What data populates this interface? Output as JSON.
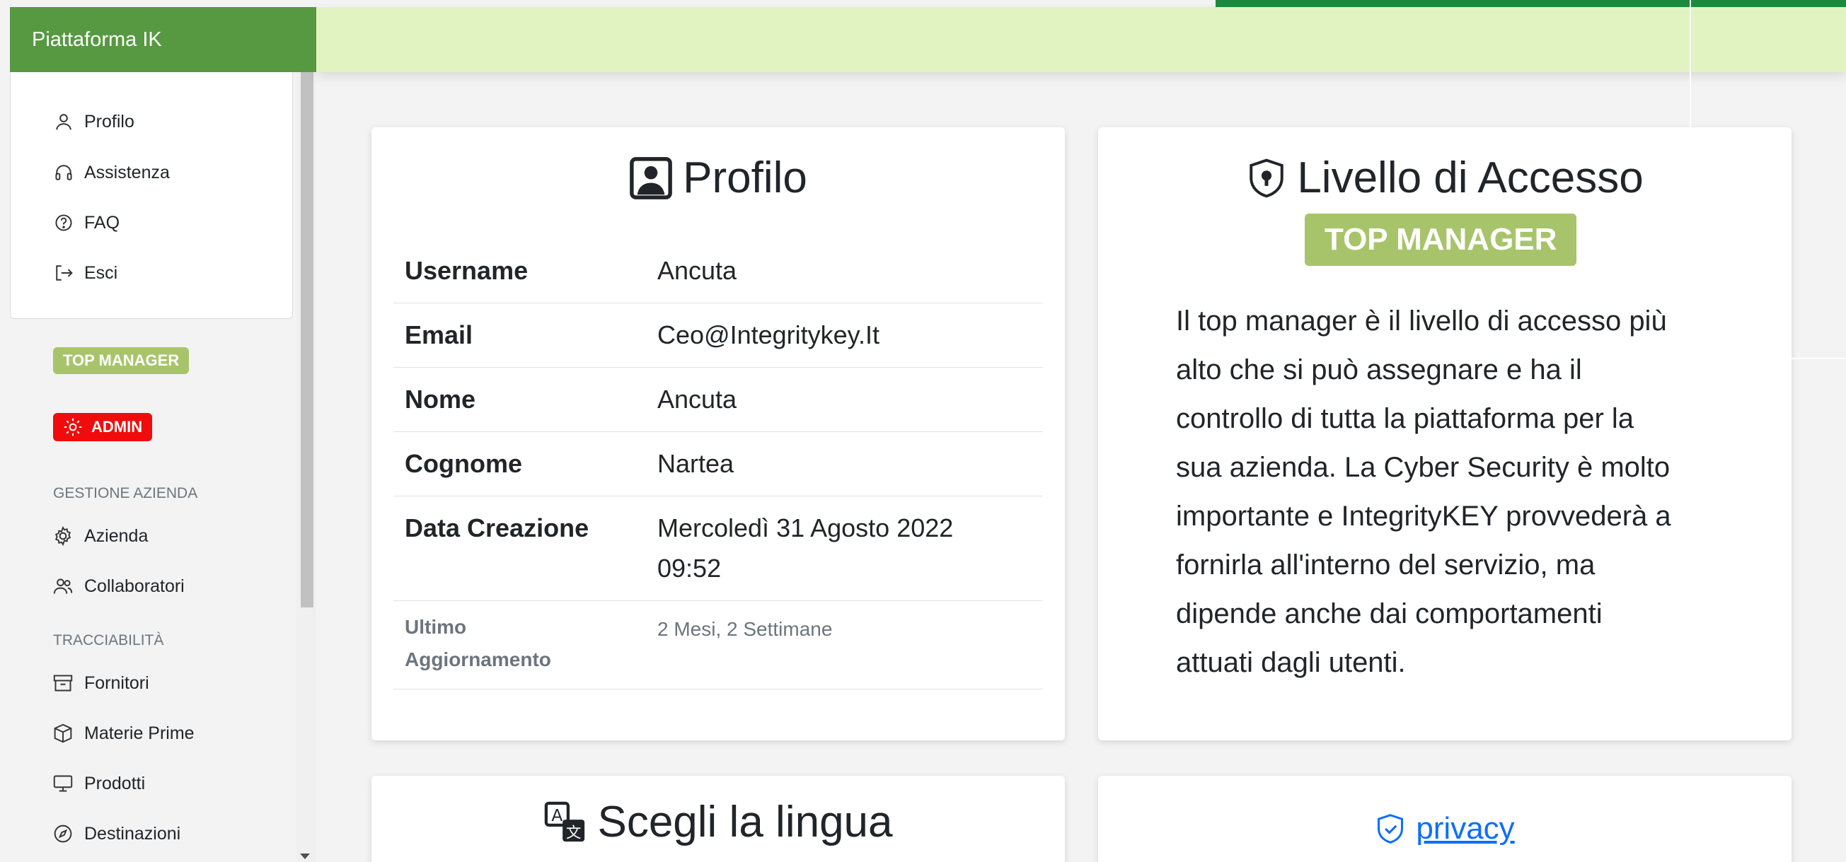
{
  "brand": "Piattaforma IK",
  "user_menu": [
    {
      "label": "Profilo",
      "icon": "person-icon"
    },
    {
      "label": "Assistenza",
      "icon": "headset-icon"
    },
    {
      "label": "FAQ",
      "icon": "question-circle-icon"
    },
    {
      "label": "Esci",
      "icon": "logout-icon"
    }
  ],
  "badges": {
    "level": "TOP MANAGER",
    "admin": "ADMIN"
  },
  "sidebar": {
    "section_company": "GESTIONE AZIENDA",
    "company_items": [
      {
        "label": "Azienda",
        "icon": "gear-icon"
      },
      {
        "label": "Collaboratori",
        "icon": "people-icon"
      }
    ],
    "section_trace": "TRACCIABILITÀ",
    "trace_items": [
      {
        "label": "Fornitori",
        "icon": "archive-icon"
      },
      {
        "label": "Materie Prime",
        "icon": "box-icon"
      },
      {
        "label": "Prodotti",
        "icon": "monitor-icon"
      },
      {
        "label": "Destinazioni",
        "icon": "compass-icon"
      }
    ]
  },
  "profile": {
    "title": "Profilo",
    "rows": [
      {
        "key": "Username",
        "value": "Ancuta"
      },
      {
        "key": "Email",
        "value": "Ceo@Integritykey.It"
      },
      {
        "key": "Nome",
        "value": "Ancuta"
      },
      {
        "key": "Cognome",
        "value": "Nartea"
      },
      {
        "key": "Data Creazione",
        "value_line1": "Mercoledì 31 Agosto 2022",
        "value_line2": "09:52"
      },
      {
        "key_line1": "Ultimo",
        "key_line2": "Aggiornamento",
        "value": "2 Mesi, 2 Settimane"
      }
    ]
  },
  "access": {
    "title": "Livello di Accesso",
    "badge": "TOP MANAGER",
    "description_lines": [
      "Il top manager è il livello di accesso più",
      "alto che si può assegnare e ha il",
      "controllo di tutta la piattaforma per la",
      "sua azienda. La Cyber Security è molto",
      "importante e IntegrityKEY provvederà a",
      "fornirla all'interno del servizio, ma",
      "dipende anche dai comportamenti",
      "attuati dagli utenti."
    ]
  },
  "language": {
    "title": "Scegli la lingua"
  },
  "privacy": {
    "label": "privacy"
  },
  "colors": {
    "brand_green": "#569941",
    "topbar": "#e1f3c0",
    "badge_green": "#a8c46a",
    "admin_red": "#f00c0c",
    "link_blue": "#0d6efd"
  }
}
